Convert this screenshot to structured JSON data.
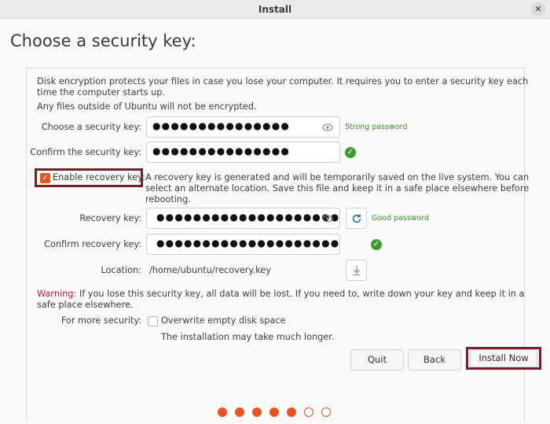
{
  "window": {
    "title": "Install",
    "close_label": "✕"
  },
  "page": {
    "title": "Choose a security key:"
  },
  "intro": {
    "line1": "Disk encryption protects your files in case you lose your computer. It requires you to enter a security key each",
    "line2": "time the computer starts up.",
    "line3": "Any files outside of Ubuntu will not be encrypted."
  },
  "security_key": {
    "label": "Choose a security key:",
    "value": "●●●●●●●●●●●●●●●",
    "strength": "Strong password"
  },
  "confirm_key": {
    "label": "Confirm the security key:",
    "value": "●●●●●●●●●●●●●●●"
  },
  "recovery": {
    "enable_label": "Enable recovery key:",
    "enabled": true,
    "desc1": "A recovery key is generated and will be temporarily saved on the live system. You can",
    "desc2": "select an alternate location. Save this file and keep it in a safe place elsewhere before",
    "desc3": "rebooting.",
    "key_label": "Recovery key:",
    "key_value": "●●●●●●●●●●●●●●●●●●●●",
    "key_strength": "Good password",
    "confirm_label": "Confirm recovery key:",
    "confirm_value": "●●●●●●●●●●●●●●●●●●●●",
    "location_label": "Location:",
    "location_value": "/home/ubuntu/recovery.key"
  },
  "warning": {
    "prefix": "Warning:",
    "line1": " If you lose this security key, all data will be lost. If you need to, write down your key and keep it in a",
    "line2": "safe place elsewhere."
  },
  "more_security": {
    "label": "For more security:",
    "option": "Overwrite empty disk space",
    "checked": false,
    "note": "The installation may take much longer."
  },
  "buttons": {
    "quit": "Quit",
    "back": "Back",
    "install": "Install Now"
  },
  "progress": {
    "completed_steps": 5,
    "total_steps": 7
  },
  "colors": {
    "accent": "#e95420",
    "success": "#3d9a2f",
    "highlight": "#7a1e2c",
    "warning": "#c7162b"
  }
}
